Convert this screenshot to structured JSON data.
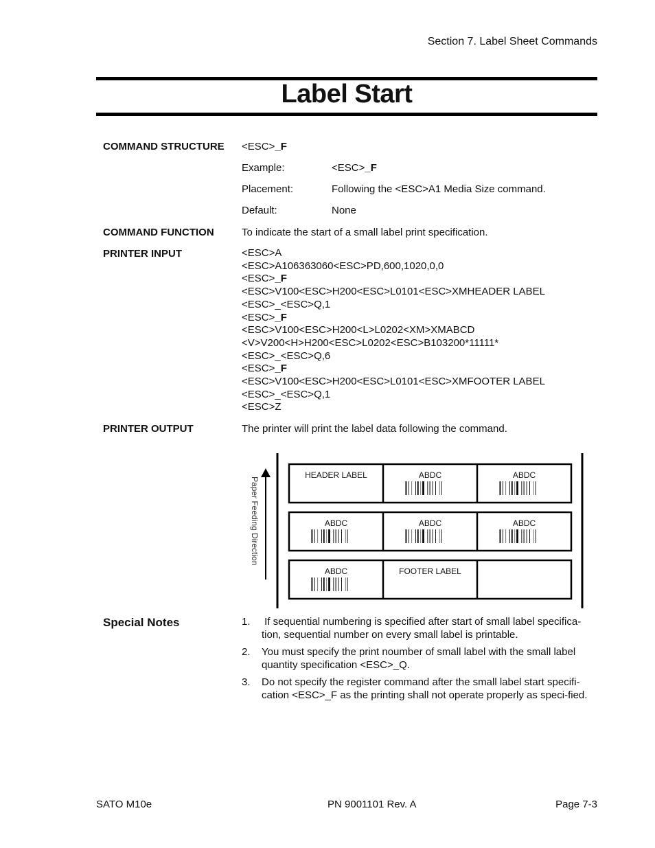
{
  "header": {
    "section": "Section 7. Label Sheet Commands"
  },
  "title": "Label Start",
  "command_structure": {
    "label": "COMMAND STRUCTURE",
    "prefix": "<ESC>",
    "command": "_F",
    "rows": [
      {
        "key": "Example:",
        "prefix": "<ESC>",
        "command": "_F",
        "value": ""
      },
      {
        "key": "Placement:",
        "value": "Following the <ESC>A1 Media Size command."
      },
      {
        "key": "Default:",
        "value": "None"
      }
    ]
  },
  "command_function": {
    "label": "COMMAND FUNCTION",
    "text": "To indicate the start of a small label print specification."
  },
  "printer_input": {
    "label": "PRINTER INPUT",
    "lines": [
      {
        "pre": "<ESC>A",
        "bold": ""
      },
      {
        "pre": "<ESC>A106363060<ESC>PD,600,1020,0,0",
        "bold": ""
      },
      {
        "pre": "<ESC>",
        "bold": "_F"
      },
      {
        "pre": "<ESC>V100<ESC>H200<ESC>L0101<ESC>XMHEADER LABEL",
        "bold": ""
      },
      {
        "pre": "<ESC>_<ESC>Q,1",
        "bold": ""
      },
      {
        "pre": "<ESC>",
        "bold": "_F"
      },
      {
        "pre": "<ESC>V100<ESC>H200<L>L0202<XM>XMABCD",
        "bold": ""
      },
      {
        "pre": "<V>V200<H>H200<ESC>L0202<ESC>B103200*11111*",
        "bold": ""
      },
      {
        "pre": "<ESC>_<ESC>Q,6",
        "bold": ""
      },
      {
        "pre": "<ESC>",
        "bold": "_F"
      },
      {
        "pre": "<ESC>V100<ESC>H200<ESC>L0101<ESC>XMFOOTER LABEL",
        "bold": ""
      },
      {
        "pre": "<ESC>_<ESC>Q,1",
        "bold": ""
      },
      {
        "pre": "<ESC>Z",
        "bold": ""
      }
    ]
  },
  "printer_output": {
    "label": "PRINTER OUTPUT",
    "text": "The printer will print the label data following the command."
  },
  "diagram": {
    "direction_label": "Paper Feeding Direction",
    "rows": [
      [
        {
          "text": "HEADER LABEL",
          "barcode": false
        },
        {
          "text": "ABDC",
          "barcode": true
        },
        {
          "text": "ABDC",
          "barcode": true
        }
      ],
      [
        {
          "text": "ABDC",
          "barcode": true
        },
        {
          "text": "ABDC",
          "barcode": true
        },
        {
          "text": "ABDC",
          "barcode": true
        }
      ],
      [
        {
          "text": "ABDC",
          "barcode": true
        },
        {
          "text": "FOOTER LABEL",
          "barcode": false
        },
        {
          "text": "",
          "barcode": false
        }
      ]
    ]
  },
  "special_notes": {
    "label": "Special Notes",
    "items": [
      {
        "num": "1.",
        "text": " If sequential numbering is specified after start of small label specifica-tion, sequential number on every small label is printable."
      },
      {
        "num": "2.",
        "text": "You must specify the print noumber of small label with the small label quantity specification <ESC>_Q."
      },
      {
        "num": "3.",
        "text": "Do not specify the register command after the small label start specifi-cation <ESC>_F as the printing shall not operate properly as speci-fied."
      }
    ]
  },
  "footer": {
    "left": "SATO M10e",
    "center": "PN 9001101 Rev. A",
    "right": "Page 7-3"
  }
}
